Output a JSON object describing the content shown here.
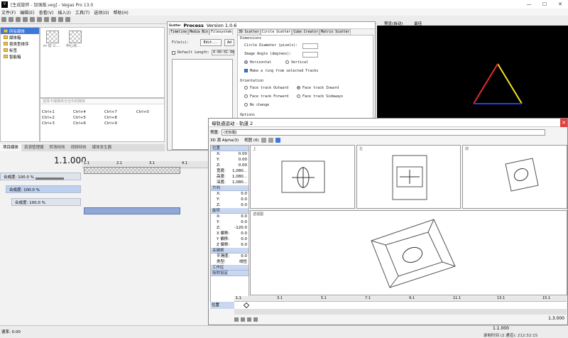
{
  "window": {
    "title": "[生成旋转 - 加强版.veg] - Vegas Pro 13.0",
    "min": "—",
    "max": "☐",
    "close": "✕"
  },
  "menu": [
    "文件(F)",
    "编辑(E)",
    "查看(V)",
    "插入(I)",
    "工具(T)",
    "选项(O)",
    "帮助(H)"
  ],
  "project_media": {
    "tree": [
      "所有媒体",
      "媒体箱",
      "按类型排序",
      "标签",
      "智能箱"
    ],
    "thumbs": [
      "m 切 三…",
      "中心点…"
    ],
    "search_placeholder": "选择卡或媒体仓位中的媒体",
    "shortcuts": [
      [
        "Ctrl+1",
        "Ctrl+4",
        "Ctrl+7",
        "Ctrl+0"
      ],
      [
        "Ctrl+2",
        "Ctrl+5",
        "Ctrl+8"
      ],
      [
        "Ctrl+3",
        "Ctrl+6",
        "Ctrl+9"
      ]
    ]
  },
  "dock_tabs": [
    "项目媒体",
    "资源管理器",
    "转场特效",
    "视频特效",
    "媒体发生器"
  ],
  "process": {
    "logo": "Scatter",
    "title": "Process",
    "version": "Version 1.0.6",
    "left_tabs": [
      "Timeline",
      "Media Bin",
      "Filesystem"
    ],
    "files_label": "File(s):",
    "edit_button": "Edit...",
    "add_button": "Ad",
    "default_length_label": "Default Length:",
    "default_length_value": "0:00:01:00",
    "right_tabs": [
      "3D Scatter",
      "Circle Scatter",
      "Cube Creator",
      "Matrix Scatter"
    ],
    "dimensions_label": "Dimensions",
    "circle_diameter_label": "Circle Diameter (pixels):",
    "image_angle_label": "Image Angle (degrees):",
    "horizontal_label": "Horizontal",
    "vertical_label": "Vertical",
    "make_ring_label": "Make a ring from selected Tracks",
    "orientation_label": "Orientation",
    "face_outward": "Face track Outward",
    "face_inward": "Face track Inward",
    "face_forward": "Face track Forward",
    "face_sideways": "Face track Sideways",
    "no_change": "No change",
    "options_label": "Options"
  },
  "preview": {
    "toolbar": "预览(自动)",
    "quality": "最佳"
  },
  "timeline": {
    "time": "1.1.000",
    "ruler": [
      "1.1",
      "2.1",
      "3.1",
      "4.1"
    ],
    "track1_label": "合成度: 100.0 %",
    "track2_label": "合成度: 100.0 %",
    "track3_label": "合成度: 100.0 %",
    "rate": "速率: 0.00"
  },
  "motion": {
    "title": "母轨道运动 - 轨道 2",
    "preset_label": "预置:",
    "preset_value": "(无标题)",
    "mode": "3D 源 Alpha(3)",
    "view_label": "视图 (6)",
    "sections": {
      "position": "位置",
      "orientation": "方向",
      "rotation": "旋转",
      "keyframe": "关键帧",
      "workspace": "工作区",
      "snap": "吸附设定"
    },
    "position_rows": [
      {
        "k": "X:",
        "v": "0.00"
      },
      {
        "k": "Y:",
        "v": "0.00"
      },
      {
        "k": "Z:",
        "v": "0.00"
      },
      {
        "k": "宽度:",
        "v": "1,080..."
      },
      {
        "k": "高度:",
        "v": "1,080..."
      },
      {
        "k": "深度:",
        "v": "1,080..."
      }
    ],
    "orientation_rows": [
      {
        "k": "X:",
        "v": "0.0"
      },
      {
        "k": "Y:",
        "v": "0.0"
      },
      {
        "k": "Z:",
        "v": "0.0"
      }
    ],
    "rotation_rows": [
      {
        "k": "X:",
        "v": "0.0"
      },
      {
        "k": "Y:",
        "v": "0.0"
      },
      {
        "k": "Z:",
        "v": "-120.0"
      },
      {
        "k": "X 偏移:",
        "v": "0.0"
      },
      {
        "k": "Y 偏移:",
        "v": "0.0"
      },
      {
        "k": "Z 偏移:",
        "v": "0.0"
      }
    ],
    "keyframe_rows": [
      {
        "k": "平滑度:",
        "v": "0.0"
      },
      {
        "k": "类型:",
        "v": "线性"
      }
    ],
    "view_labels": [
      "上",
      "左",
      "前",
      "透视图"
    ],
    "kf_ruler": [
      "1.1",
      "3.1",
      "5.1",
      "7.1",
      "9.1",
      "11.1",
      "13.1",
      "15.1"
    ],
    "kf_track_label": "位置",
    "kf_time": "1.3.000",
    "kf_time2": "1.1.000",
    "rec_time": "录制时间 (2 通道): 212:32:15"
  }
}
